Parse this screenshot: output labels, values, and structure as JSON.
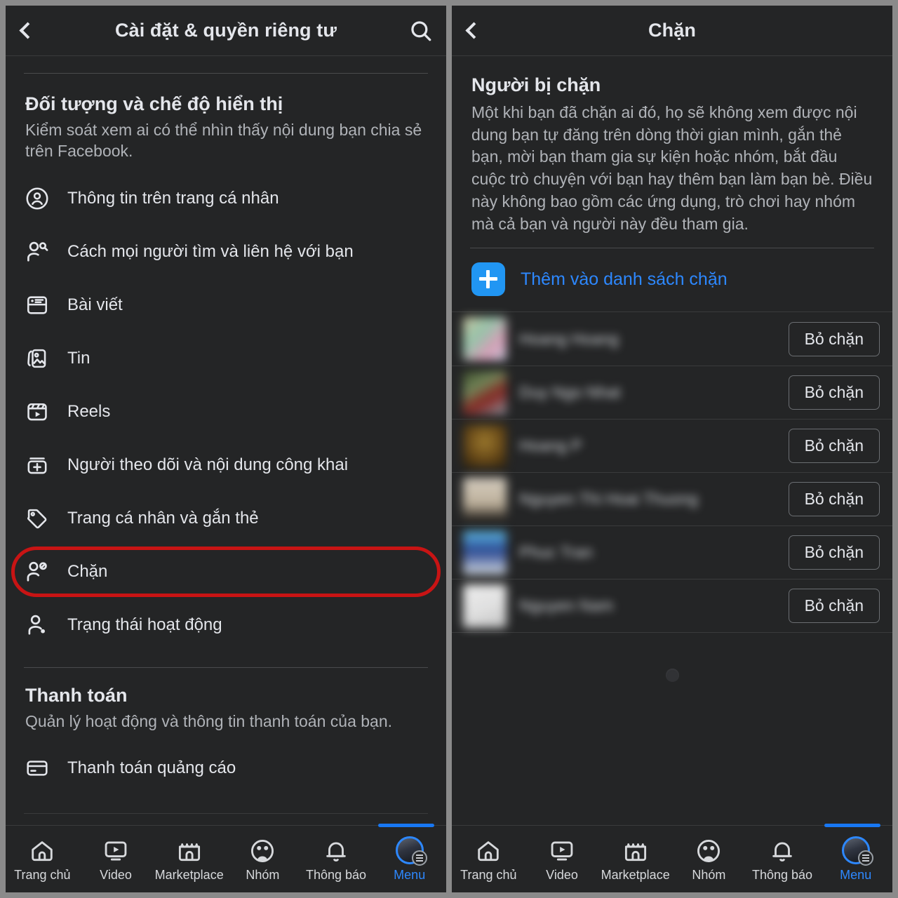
{
  "left": {
    "header": {
      "title": "Cài đặt & quyền riêng tư",
      "back_icon": "chevron-left-icon",
      "search_icon": "search-icon"
    },
    "section_audience": {
      "title": "Đối tượng và chế độ hiển thị",
      "description": "Kiểm soát xem ai có thể nhìn thấy nội dung bạn chia sẻ trên Facebook.",
      "items": [
        {
          "label": "Thông tin trên trang cá nhân",
          "icon": "profile-circle-icon",
          "highlighted": false
        },
        {
          "label": "Cách mọi người tìm và liên hệ với bạn",
          "icon": "person-search-icon",
          "highlighted": false
        },
        {
          "label": "Bài viết",
          "icon": "posts-card-icon",
          "highlighted": false
        },
        {
          "label": "Tin",
          "icon": "stories-photo-icon",
          "highlighted": false
        },
        {
          "label": "Reels",
          "icon": "reels-clapper-icon",
          "highlighted": false
        },
        {
          "label": "Người theo dõi và nội dung công khai",
          "icon": "follower-add-icon",
          "highlighted": false
        },
        {
          "label": "Trang cá nhân và gắn thẻ",
          "icon": "tag-icon",
          "highlighted": false
        },
        {
          "label": "Chặn",
          "icon": "person-block-icon",
          "highlighted": true
        },
        {
          "label": "Trạng thái hoạt động",
          "icon": "person-active-icon",
          "highlighted": false
        }
      ]
    },
    "section_payment": {
      "title": "Thanh toán",
      "description": "Quản lý hoạt động và thông tin thanh toán của bạn.",
      "items": [
        {
          "label": "Thanh toán quảng cáo",
          "icon": "credit-card-icon"
        }
      ]
    }
  },
  "right": {
    "header": {
      "title": "Chặn",
      "back_icon": "chevron-left-icon"
    },
    "blocked_section": {
      "title": "Người bị chặn",
      "description": "Một khi bạn đã chặn ai đó, họ sẽ không xem được nội dung bạn tự đăng trên dòng thời gian mình, gắn thẻ bạn, mời bạn tham gia sự kiện hoặc nhóm, bắt đầu cuộc trò chuyện với bạn hay thêm bạn làm bạn bè. Điều này không bao gồm các ứng dụng, trò chơi hay nhóm mà cả bạn và người này đều tham gia.",
      "add_label": "Thêm vào danh sách chặn",
      "add_icon": "plus-square-icon",
      "unblock_label": "Bỏ chặn",
      "rows": [
        {
          "name": "Hoang Hoang",
          "redacted": true,
          "avatar_colors": [
            "#d8cfa8",
            "#9fd2b6",
            "#e7a9c4",
            "#cbd6e8"
          ]
        },
        {
          "name": "Duy Ngo Nhat",
          "redacted": true,
          "avatar_colors": [
            "#3d4d2a",
            "#7a8f5e",
            "#8d2520",
            "#98a4b0"
          ]
        },
        {
          "name": "Hoang P",
          "redacted": true,
          "avatar_colors": [
            "#6b4a16",
            "#a8822f",
            "#4a3310",
            "#2a1d08"
          ]
        },
        {
          "name": "Nguyen Thi Hoai Thuong",
          "redacted": true,
          "avatar_colors": [
            "#e3dacb",
            "#cbbda6",
            "#16120e",
            "#d9cfbd"
          ]
        },
        {
          "name": "Phuc Tran",
          "redacted": true,
          "avatar_colors": [
            "#63c8f5",
            "#2b4a9a",
            "#e8eef4",
            "#b9d8ee"
          ]
        },
        {
          "name": "Nguyen Nam",
          "redacted": true,
          "avatar_colors": [
            "#f2f2f2",
            "#e0e0e0",
            "#cfcfcf",
            "#ffffff"
          ]
        }
      ],
      "loading_indicator": "loading-spinner"
    }
  },
  "bottom_nav": {
    "items": [
      {
        "label": "Trang chủ",
        "icon": "home-icon",
        "active": false
      },
      {
        "label": "Video",
        "icon": "video-icon",
        "active": false
      },
      {
        "label": "Marketplace",
        "icon": "marketplace-icon",
        "active": false
      },
      {
        "label": "Nhóm",
        "icon": "groups-icon",
        "active": false
      },
      {
        "label": "Thông báo",
        "icon": "bell-icon",
        "active": false
      },
      {
        "label": "Menu",
        "icon": "menu-avatar-icon",
        "active": true
      }
    ]
  },
  "colors": {
    "background": "#242526",
    "accent_blue": "#2d88ff",
    "highlight_red": "#c81414",
    "text_primary": "#e4e6eb",
    "text_secondary": "#b0b3b8",
    "gutter": "#8a8a8a"
  }
}
